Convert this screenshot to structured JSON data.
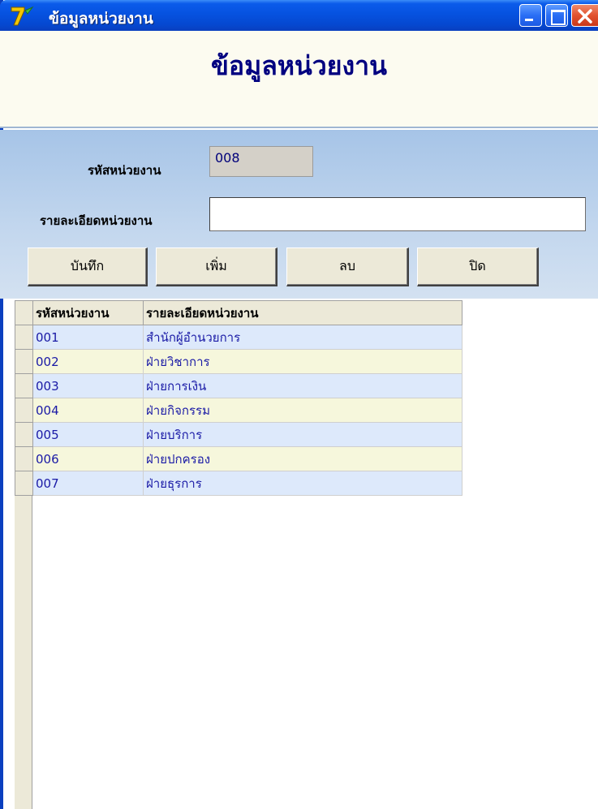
{
  "window": {
    "title": "ข้อมูลหน่วยงาน",
    "icon": "app-logo-icon",
    "controls": [
      "minimize-icon",
      "maximize-icon",
      "close-icon"
    ]
  },
  "form": {
    "heading": "ข้อมูลหน่วยงาน"
  },
  "fields": {
    "code_label": "รหัสหน่วยงาน",
    "code_value": "008",
    "desc_label": "รายละเอียดหน่วยงาน",
    "desc_value": ""
  },
  "buttons": {
    "save": "บันทึก",
    "add": "เพิ่ม",
    "delete": "ลบ",
    "close": "ปิด"
  },
  "grid": {
    "columns": [
      "รหัสหน่วยงาน",
      "รายละเอียดหน่วยงาน"
    ],
    "rows": [
      {
        "code": "001",
        "desc": "สำนักผู้อำนวยการ"
      },
      {
        "code": "002",
        "desc": "ฝ่ายวิชาการ"
      },
      {
        "code": "003",
        "desc": "ฝ่ายการเงิน"
      },
      {
        "code": "004",
        "desc": "ฝ่ายกิจกรรม"
      },
      {
        "code": "005",
        "desc": "ฝ่ายบริการ"
      },
      {
        "code": "006",
        "desc": "ฝ่ายปกครอง"
      },
      {
        "code": "007",
        "desc": "ฝ่ายธุรการ"
      }
    ]
  },
  "colors": {
    "titlebar": "#0652e0",
    "heading_text": "#000080",
    "grid_text": "#1a1aa6",
    "row_odd": "#dde9fb",
    "row_even": "#f6f7dc"
  }
}
